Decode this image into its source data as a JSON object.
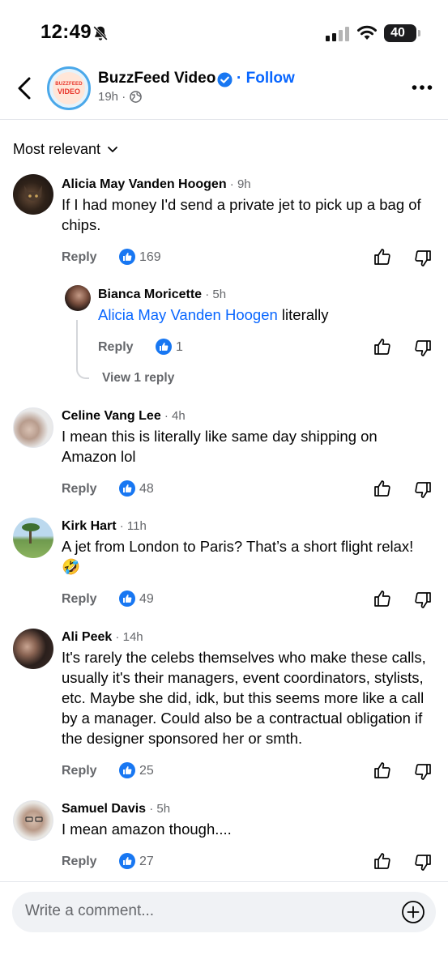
{
  "status_bar": {
    "time": "12:49",
    "battery": "40"
  },
  "header": {
    "page_name": "BuzzFeed Video",
    "follow_label": "Follow",
    "separator": "·",
    "timestamp": "19h ·",
    "logo_line1": "BUZZFEED",
    "logo_line2": "VIDEO"
  },
  "sort": {
    "label": "Most relevant"
  },
  "reply_label": "Reply",
  "comments": [
    {
      "author": "Alicia May Vanden Hoogen",
      "ago": " · 9h",
      "text": "If I had money I'd send a private jet to pick up a bag of chips.",
      "likes": "169"
    },
    {
      "author": "Bianca Moricette",
      "ago": " · 5h",
      "mention": "Alicia May Vanden Hoogen",
      "text": " literally",
      "likes": "1",
      "view_replies": "View 1 reply"
    },
    {
      "author": "Celine Vang Lee",
      "ago": " · 4h",
      "text": "I mean this is literally like same day shipping on Amazon lol",
      "likes": "48"
    },
    {
      "author": "Kirk Hart",
      "ago": " · 11h",
      "text": "A jet from London to Paris? That’s a short flight relax!",
      "emoji": "🤣",
      "likes": "49"
    },
    {
      "author": "Ali Peek",
      "ago": " · 14h",
      "text": "It's rarely the celebs themselves who make these calls, usually it's their managers, event coordinators, stylists, etc. Maybe she did, idk, but this seems more like a call by a manager. Could also be a contractual obligation if the designer sponsored her or smth.",
      "likes": "25"
    },
    {
      "author": "Samuel Davis",
      "ago": " · 5h",
      "text": "I mean amazon though....",
      "likes": "27"
    }
  ],
  "composer": {
    "placeholder": "Write a comment..."
  },
  "colors": {
    "link_blue": "#0866ff",
    "like_blue": "#1877f2",
    "secondary_text": "#65676b"
  },
  "icons": [
    "bell-slash-icon",
    "signal-icon",
    "wifi-icon",
    "battery-icon",
    "back-chevron-icon",
    "verified-badge-icon",
    "globe-icon",
    "more-icon",
    "chevron-down-icon",
    "like-icon",
    "thumbs-up-icon",
    "thumbs-down-icon",
    "plus-circle-icon"
  ]
}
